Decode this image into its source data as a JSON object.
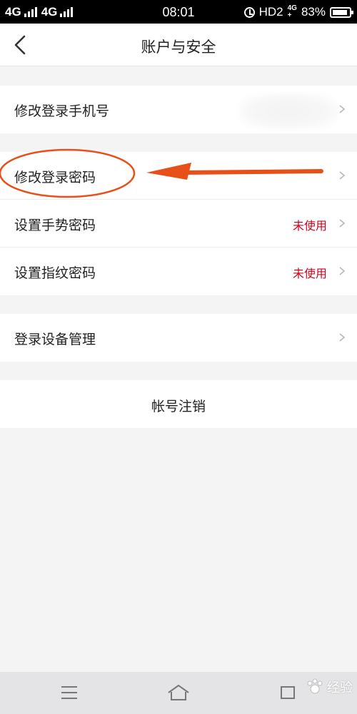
{
  "status_bar": {
    "signal1": "4G",
    "signal2": "4G",
    "time": "08:01",
    "hd": "HD2",
    "net_top": "4G",
    "net_bottom": "+",
    "battery": "83%"
  },
  "header": {
    "title": "账户与安全",
    "back_icon": "chevron-left-icon"
  },
  "groups": {
    "phone": {
      "label": "修改登录手机号"
    },
    "passwords": {
      "change_password": {
        "label": "修改登录密码"
      },
      "gesture": {
        "label": "设置手势密码",
        "status": "未使用"
      },
      "fingerprint": {
        "label": "设置指纹密码",
        "status": "未使用"
      }
    },
    "devices": {
      "label": "登录设备管理"
    },
    "account": {
      "label": "帐号注销"
    }
  },
  "colors": {
    "status_text": "#d0021b",
    "annotation": "#e8501a",
    "background": "#f4f4f5"
  },
  "bottom_bar": {
    "menu_icon": "menu-icon",
    "home_icon": "home-icon",
    "back_icon": "back-icon",
    "watermark": "经验"
  }
}
